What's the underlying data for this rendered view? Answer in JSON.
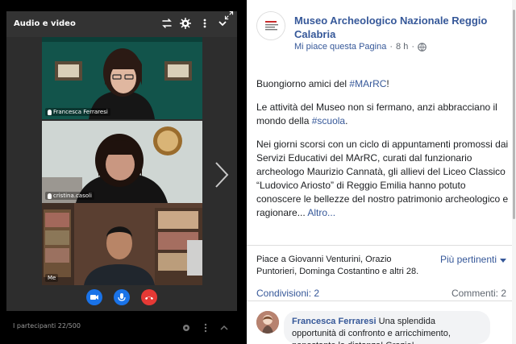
{
  "meet": {
    "title": "Audio e video",
    "participants": [
      {
        "name": "Francesca Ferraresi"
      },
      {
        "name": "cristina.casoli"
      },
      {
        "name": "Me"
      }
    ],
    "participants_count": "I partecipanti 22/500"
  },
  "post": {
    "page_name": "Museo Archeologico Nazionale Reggio Calabria",
    "meta_like": "Mi piace questa Pagina",
    "meta_separator": "·",
    "meta_time": "8 h",
    "meta_sep2": "·",
    "greeting_prefix": "Buongiorno amici del ",
    "greeting_tag": "#MArRC",
    "greeting_suffix": "!",
    "para2_prefix": "Le attività del Museo non si fermano, anzi abbracciano il mondo della ",
    "para2_tag": "#scuola",
    "para2_suffix": ".",
    "para3": "Nei giorni scorsi con un ciclo di appuntamenti promossi dai Servizi Educativi del MArRC, curati dal funzionario archeologo Maurizio Cannatà, gli allievi del Liceo Classico “Ludovico Ariosto” di Reggio Emilia hanno potuto conoscere le bellezze del nostro patrimonio archeologico e ragionare...",
    "read_more": "Altro...",
    "reactors": "Piace a Giovanni Venturini, Orazio Puntorieri, Dominga Costantino e altri 28.",
    "most_relevant": "Più pertinenti",
    "shares": "Condivisioni: 2",
    "comments": "Commenti: 2",
    "comment": {
      "author": "Francesca Ferraresi",
      "text": " Una splendida opportunità di confronto e arricchimento, nonostante la distanza! Grazie!"
    }
  },
  "colors": {
    "facebook_link": "#365899",
    "meet_accent": "#1a73e8",
    "hangup": "#e53935"
  },
  "icons": {
    "swap": "swap-icon",
    "settings": "gear-icon",
    "more": "more-vert-icon",
    "collapse": "chevron-down-icon",
    "expand": "expand-icon",
    "camera": "camera-icon",
    "mic": "microphone-icon",
    "hangup": "hangup-icon",
    "globe": "globe-icon"
  }
}
